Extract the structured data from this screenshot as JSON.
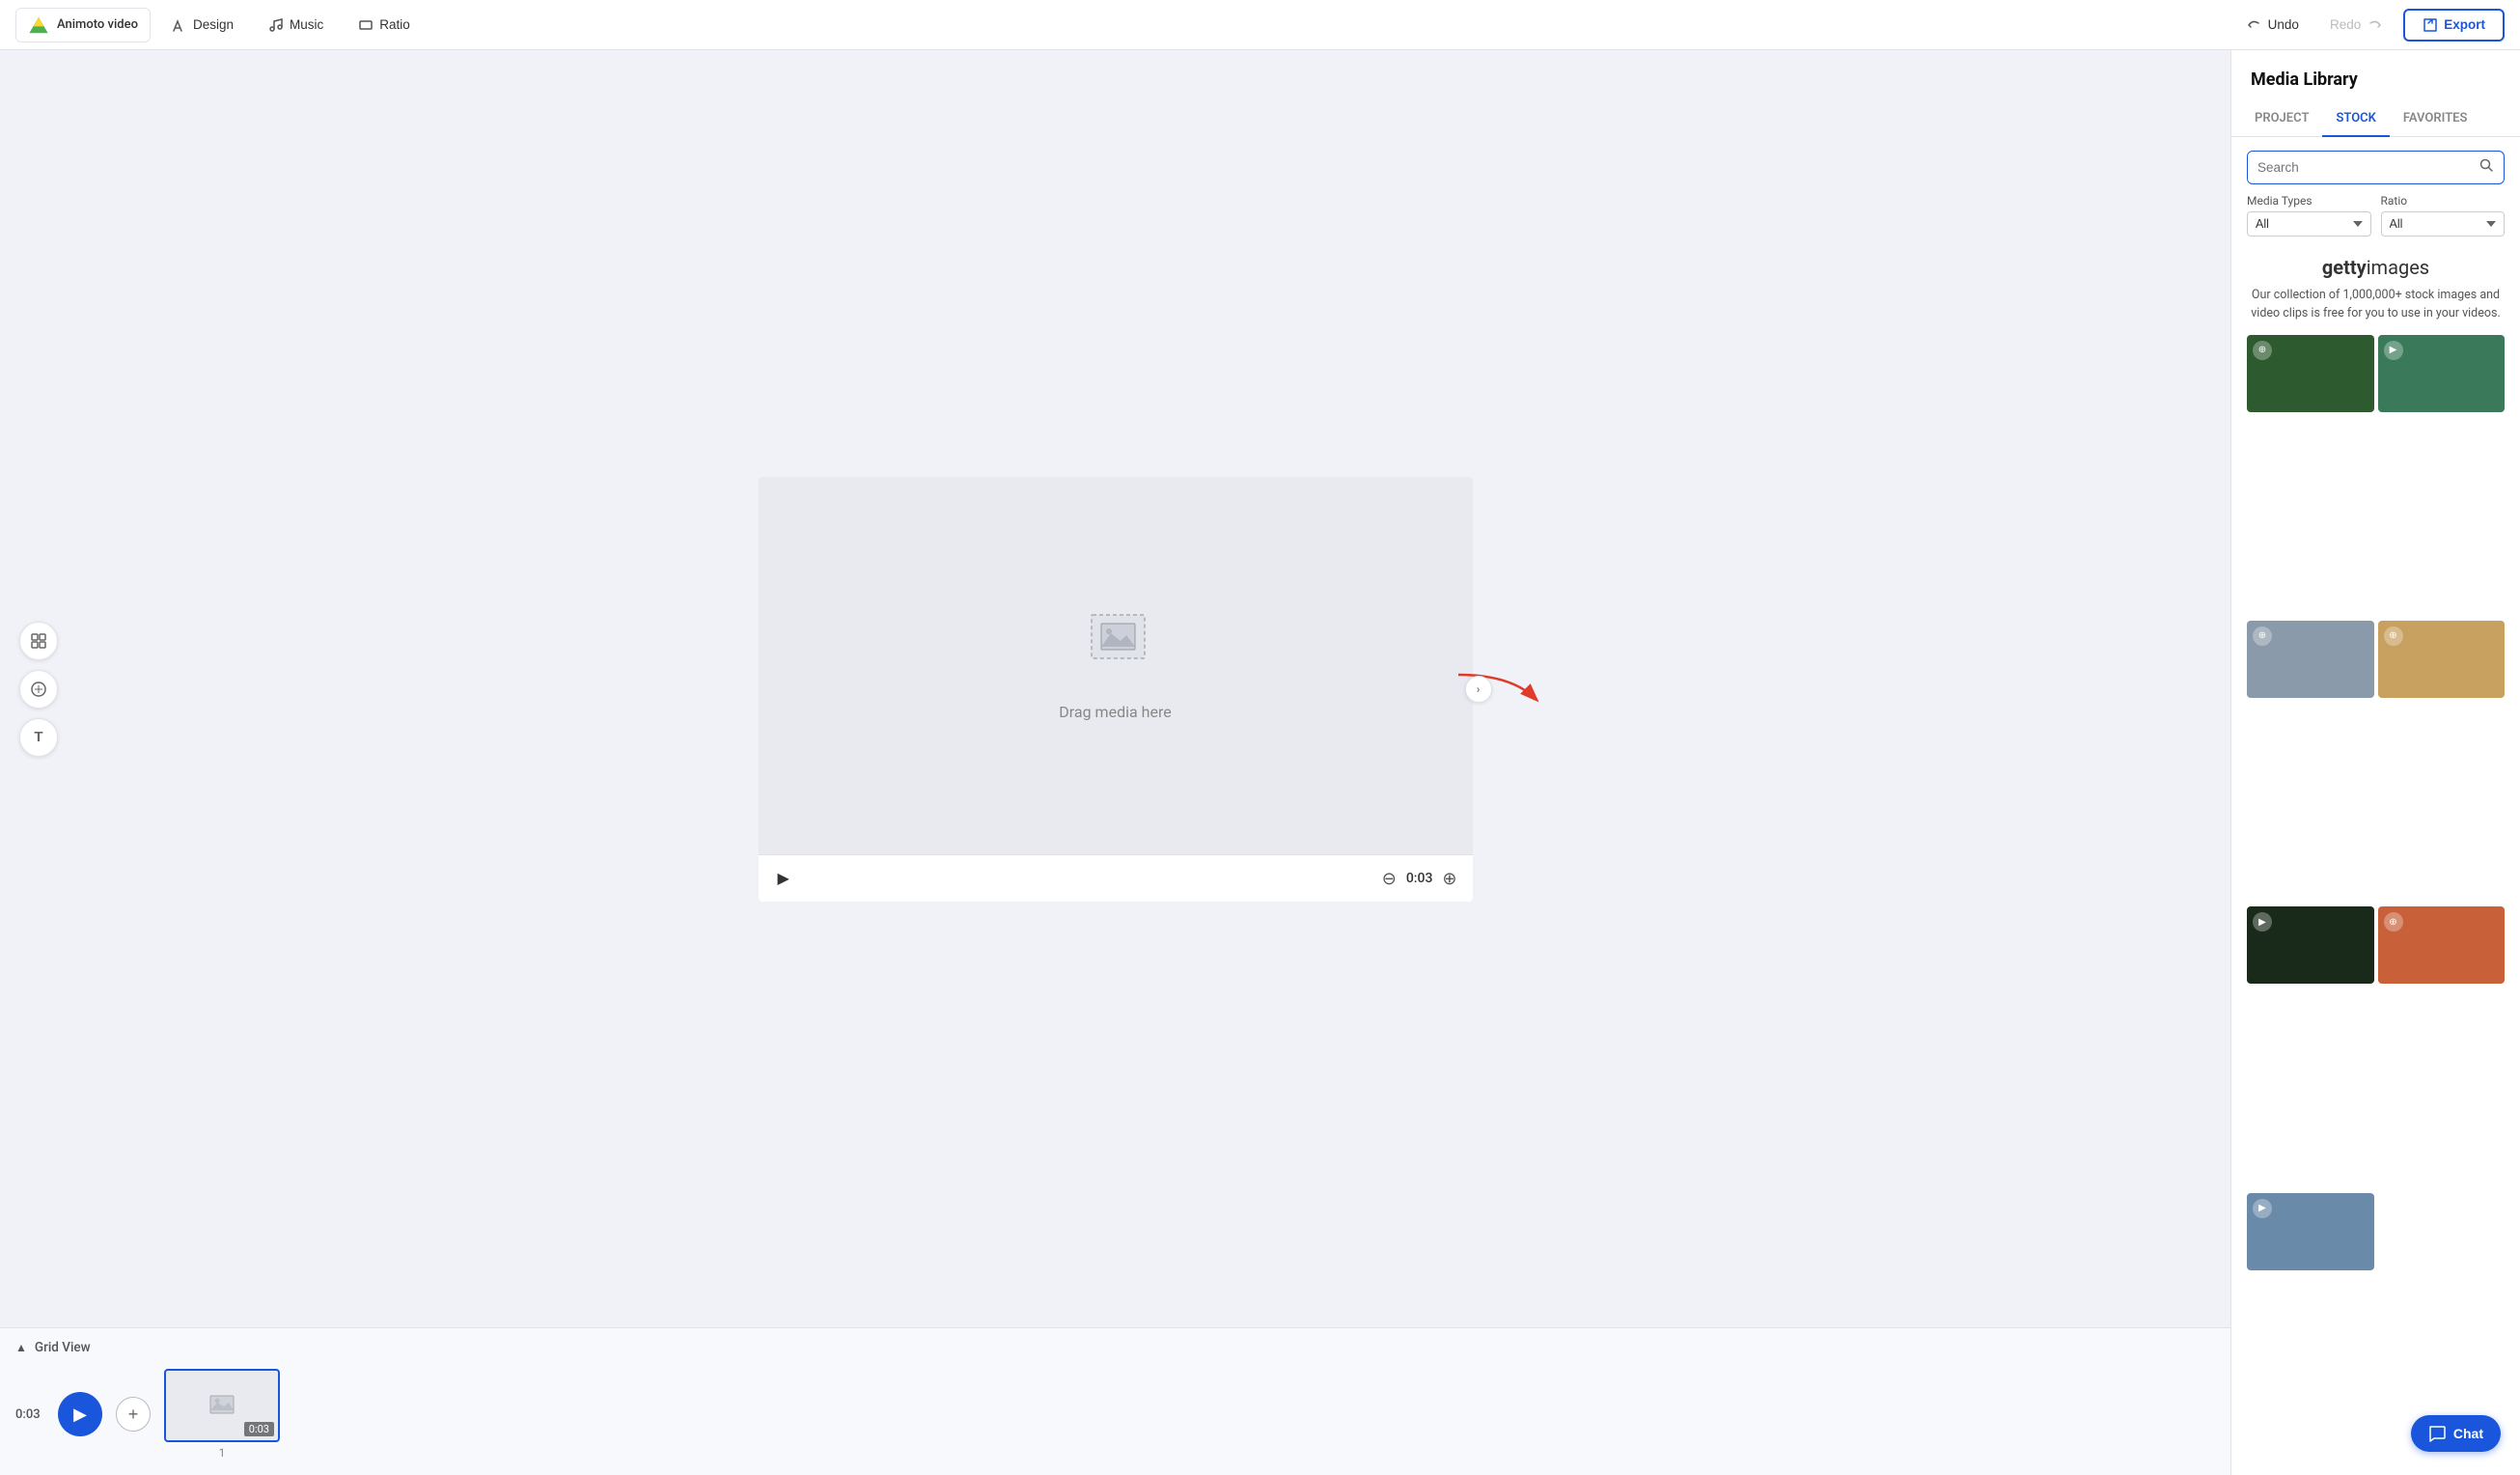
{
  "app": {
    "name": "Animoto video",
    "logo_label": "Animoto video"
  },
  "topbar": {
    "design_label": "Design",
    "music_label": "Music",
    "ratio_label": "Ratio",
    "undo_label": "Undo",
    "redo_label": "Redo",
    "export_label": "Export"
  },
  "left_toolbar": {
    "layout_icon": "▦",
    "color_icon": "◉",
    "text_icon": "T"
  },
  "canvas": {
    "drag_text": "Drag media here",
    "time": "0:03"
  },
  "timeline": {
    "grid_view_label": "Grid View",
    "time": "0:03",
    "clip_duration": "0:03",
    "clip_number": "1"
  },
  "media_library": {
    "title": "Media Library",
    "tabs": [
      {
        "label": "PROJECT",
        "active": false
      },
      {
        "label": "STOCK",
        "active": true
      },
      {
        "label": "FAVORITES",
        "active": false
      }
    ],
    "search_placeholder": "Search",
    "filter": {
      "media_types_label": "Media Types",
      "media_types_value": "All",
      "ratio_label": "Ratio",
      "ratio_value": "All"
    },
    "getty_logo": "gettyimages",
    "getty_desc": "Our collection of 1,000,000+ stock images and video clips is free for you to use in your videos.",
    "media_items": [
      {
        "type": "image",
        "class": "thumb-leaves"
      },
      {
        "type": "video",
        "class": "thumb-palm"
      },
      {
        "type": "image",
        "class": "thumb-wood"
      },
      {
        "type": "image",
        "class": "thumb-autumn"
      },
      {
        "type": "video",
        "class": "thumb-flower"
      },
      {
        "type": "image",
        "class": "thumb-redleaf"
      },
      {
        "type": "image",
        "class": "thumb-temple"
      }
    ]
  },
  "chat": {
    "label": "Chat"
  }
}
